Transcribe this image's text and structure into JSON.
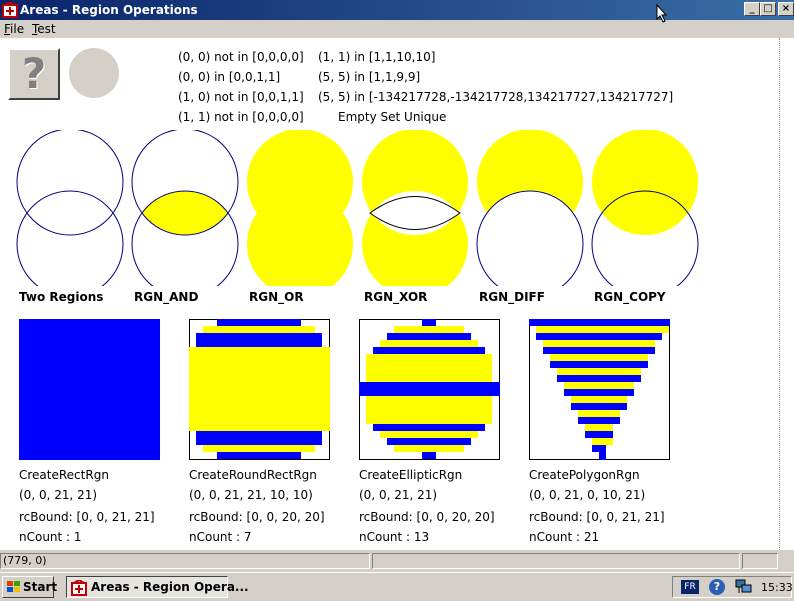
{
  "window": {
    "title": "Areas - Region Operations",
    "buttons": {
      "min": "_",
      "max": "□",
      "close": "×"
    }
  },
  "menu": [
    {
      "label": "File",
      "accel": "F",
      "rest": "ile"
    },
    {
      "label": "Test",
      "accel": "T",
      "rest": "est"
    }
  ],
  "tests": {
    "col1": [
      "(0, 0) not in [0,0,0,0]",
      "(0, 0) in [0,0,1,1]",
      "(1, 0) not in [0,0,1,1]",
      "(1, 1) not in [0,0,0,0]"
    ],
    "col2": [
      "(1, 1) in [1,1,10,10]",
      "(5, 5) in [1,1,9,9]",
      "(5, 5) in [-134217728,-134217728,134217727,134217727]",
      "Empty Set Unique"
    ]
  },
  "region_ops": [
    "Two Regions",
    "RGN_AND",
    "RGN_OR",
    "RGN_XOR",
    "RGN_DIFF",
    "RGN_COPY"
  ],
  "shapes": [
    {
      "name": "CreateRectRgn",
      "args": "(0, 0, 21, 21)",
      "bound": "rcBound: [0, 0, 21, 21]",
      "count": "nCount : 1"
    },
    {
      "name": "CreateRoundRectRgn",
      "args": "(0, 0, 21, 21, 10, 10)",
      "bound": "rcBound: [0, 0, 20, 20]",
      "count": "nCount : 7"
    },
    {
      "name": "CreateEllipticRgn",
      "args": "(0, 0, 21, 21)",
      "bound": "rcBound: [0, 0, 20, 20]",
      "count": "nCount : 13"
    },
    {
      "name": "CreatePolygonRgn",
      "args": "(0, 0, 21, 0, 10, 21)",
      "bound": "rcBound: [0, 0, 21, 21]",
      "count": "nCount : 21"
    }
  ],
  "status": {
    "coords": "(779, 0)"
  },
  "taskbar": {
    "start": "Start",
    "task": "Areas - Region Opera...",
    "lang": "FR",
    "help": "?",
    "clock": "15:33"
  },
  "colors": {
    "yellow": "#ffff00",
    "blue": "#0000ff",
    "outline": "#000080",
    "title": "#0a246a"
  },
  "icons": [
    "help-icon",
    "app-icon",
    "windows-logo-icon",
    "network-icon",
    "cursor-icon"
  ]
}
